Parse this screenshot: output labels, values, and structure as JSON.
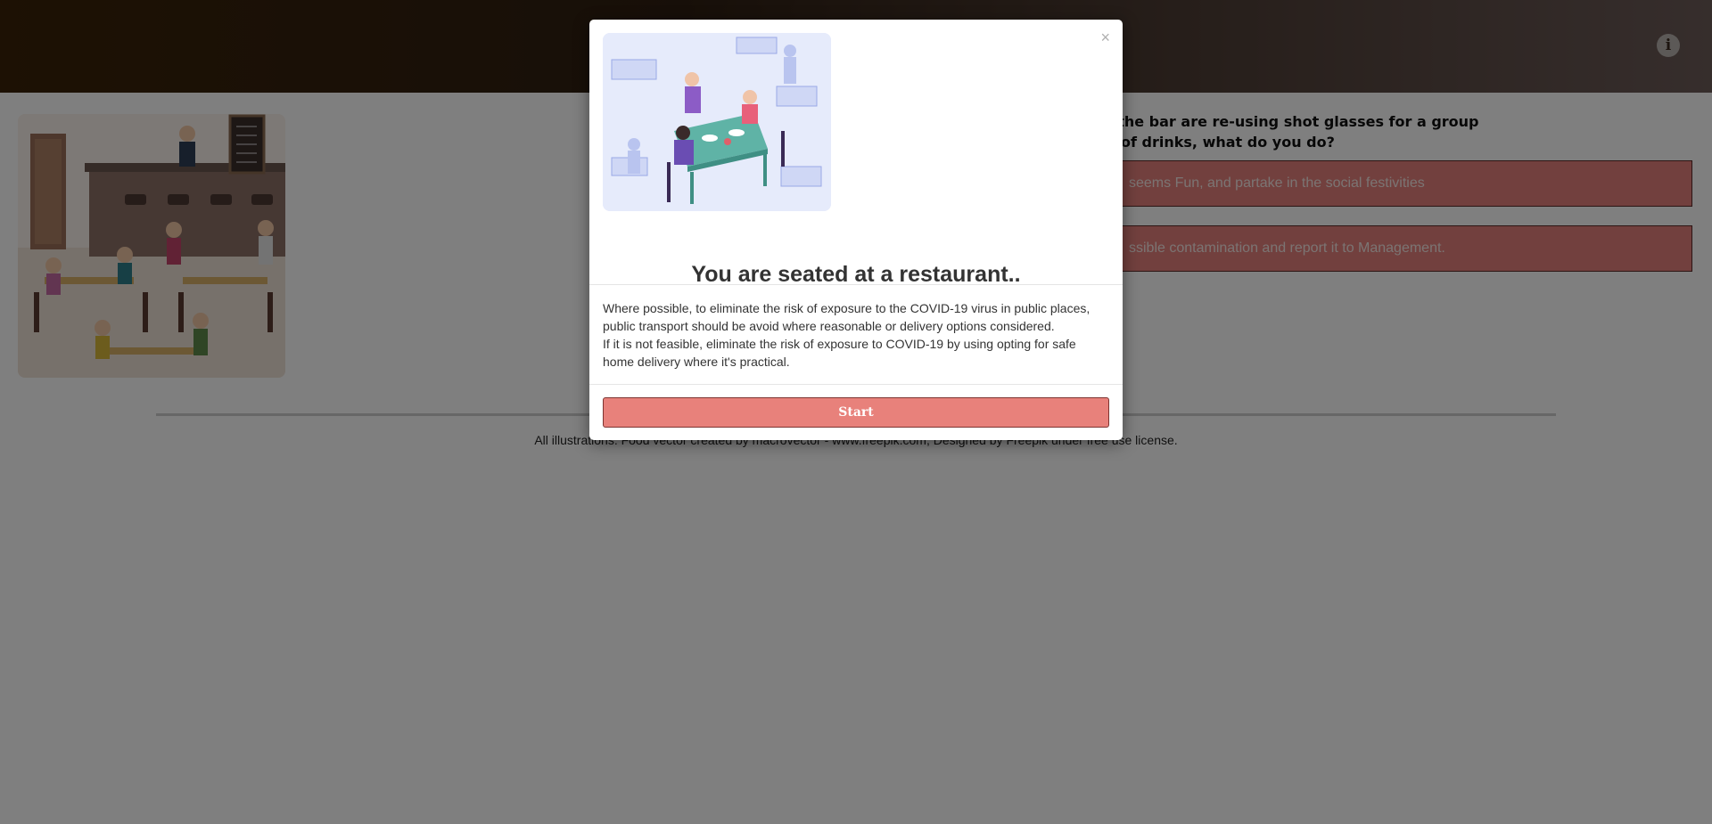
{
  "header": {
    "info_icon": "info-icon"
  },
  "question": {
    "text": "t the bar are re-using shot glasses for a group\nd of drinks, what do you do?",
    "answers": [
      {
        "label": "seems Fun, and partake in the social festivities"
      },
      {
        "label": "ssible contamination and report it to Management."
      }
    ]
  },
  "footer": {
    "credits": "All illustrations: Food vector created by macrovector - www.freepik.com, Designed by Freepik under free use license."
  },
  "modal": {
    "close_label": "×",
    "title": "You are seated at a restaurant..",
    "body_line1": "Where possible, to eliminate the risk of exposure to the COVID-19 virus in public places, public transport should be avoid where reasonable or delivery options considered.",
    "body_line2": "If it is not feasible, eliminate the risk of exposure to COVID-19 by using opting for safe home delivery where it's practical.",
    "start_label": "Start"
  },
  "colors": {
    "accent": "#e8817b",
    "answer_bg": "#e4807c",
    "header_dark": "#2f1f12"
  }
}
